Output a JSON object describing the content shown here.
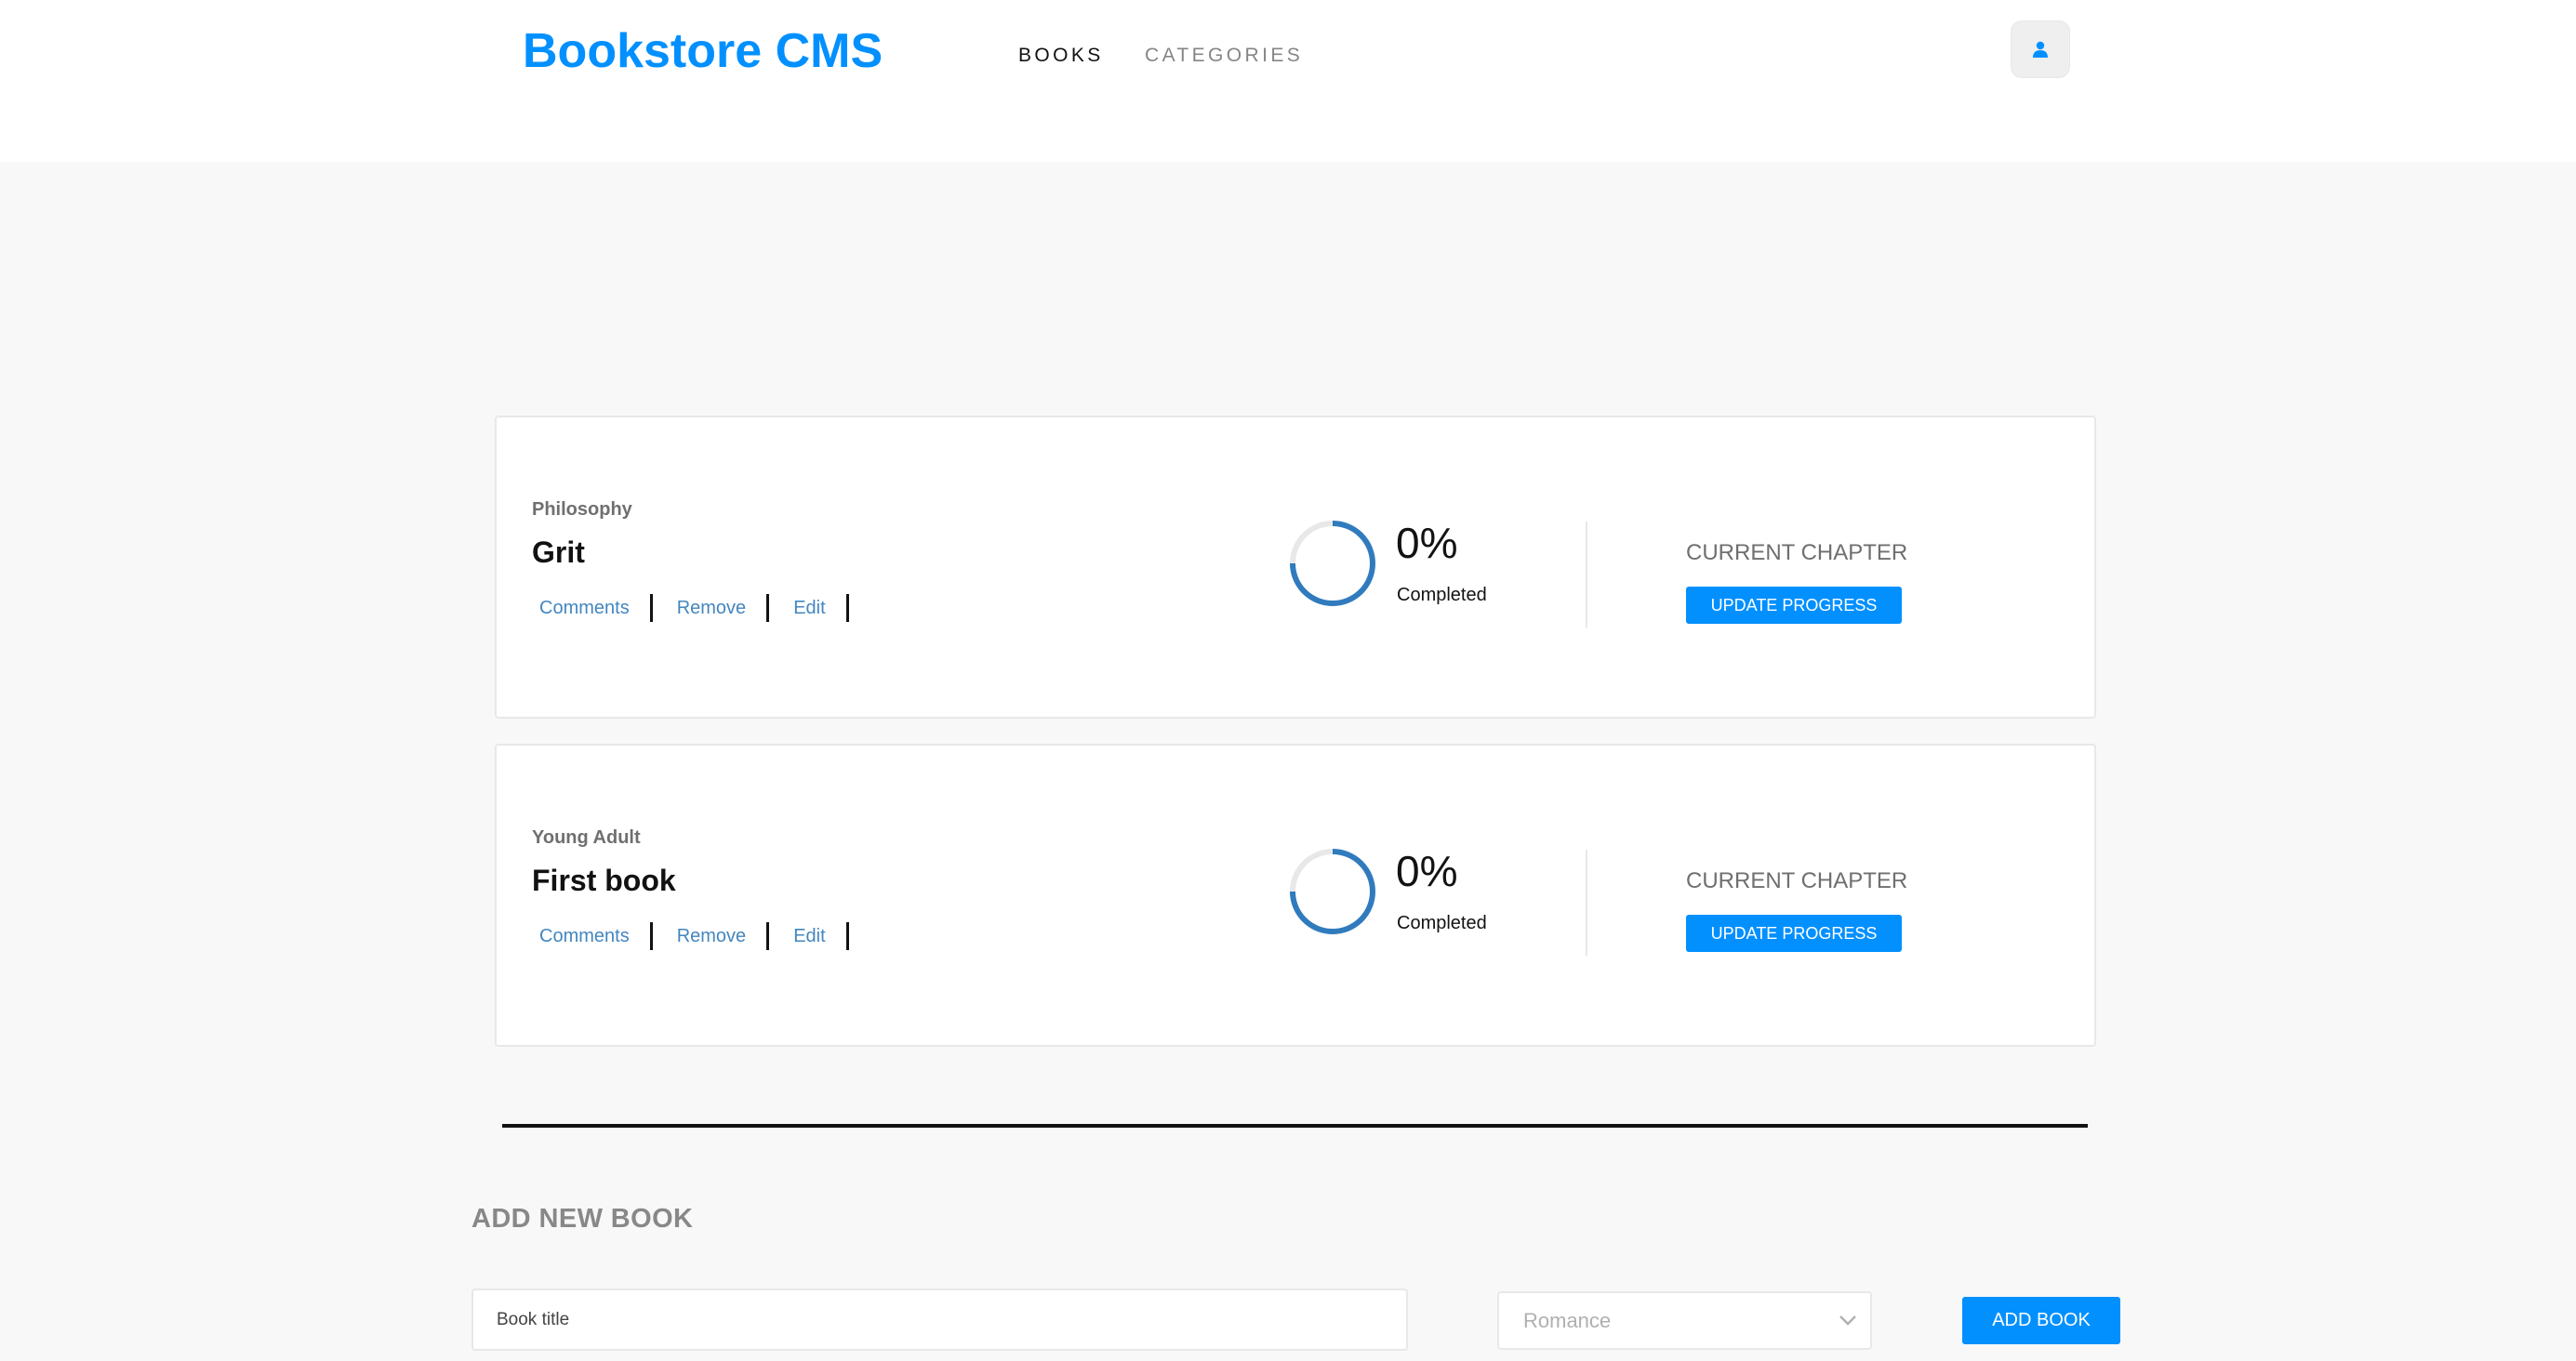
{
  "header": {
    "logo": "Bookstore CMS",
    "nav": {
      "books": "BOOKS",
      "categories": "CATEGORIES"
    },
    "avatar_icon": "user-icon",
    "accent_color": "#0290ff"
  },
  "books": [
    {
      "genre": "Philosophy",
      "title": "Grit",
      "actions": {
        "comments": "Comments",
        "remove": "Remove",
        "edit": "Edit"
      },
      "progress_percent": 0,
      "percent_label": "0%",
      "completed_label": "Completed",
      "chapter_label": "CURRENT CHAPTER",
      "update_label": "UPDATE PROGRESS"
    },
    {
      "genre": "Young Adult",
      "title": "First book",
      "actions": {
        "comments": "Comments",
        "remove": "Remove",
        "edit": "Edit"
      },
      "progress_percent": 0,
      "percent_label": "0%",
      "completed_label": "Completed",
      "chapter_label": "CURRENT CHAPTER",
      "update_label": "UPDATE PROGRESS"
    }
  ],
  "form": {
    "heading": "ADD NEW BOOK",
    "title_placeholder": "Book title",
    "category_selected": "Romance",
    "submit_label": "ADD BOOK"
  }
}
